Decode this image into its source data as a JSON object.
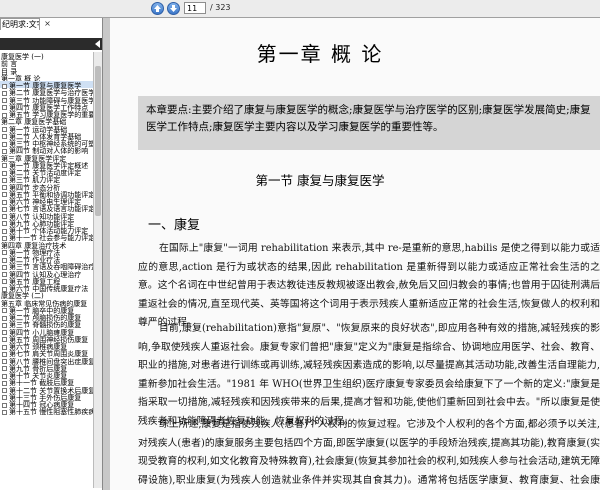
{
  "toolbar": {
    "up_icon": "arrow-up-icon",
    "down_icon": "arrow-down-icon",
    "current_page": "11",
    "total_pages": "/ 323"
  },
  "sidebar": {
    "tab_title": "纪明求:文字版",
    "close_glyph": "×",
    "outline": [
      {
        "level": 0,
        "text": "康复医学 (一)"
      },
      {
        "level": 0,
        "text": "前  言"
      },
      {
        "level": 0,
        "text": "目  录"
      },
      {
        "level": 0,
        "text": "第一章  概  论"
      },
      {
        "level": 2,
        "text": "第一节  康复与康复医学"
      },
      {
        "level": 2,
        "text": "第二节  康复医学与治疗医学"
      },
      {
        "level": 2,
        "text": "第三节  功能障碍与康复医学"
      },
      {
        "level": 2,
        "text": "第四节  康复医学工作特点"
      },
      {
        "level": 2,
        "text": "第五节  学习康复医学的重要性"
      },
      {
        "level": 0,
        "text": "第二章  康复医学基础"
      },
      {
        "level": 2,
        "text": "第一节  运动学基础"
      },
      {
        "level": 2,
        "text": "第二节  人体发育学基础"
      },
      {
        "level": 2,
        "text": "第三节  中枢神经系统的可塑性"
      },
      {
        "level": 2,
        "text": "第四节  制动对人体的影响"
      },
      {
        "level": 0,
        "text": "第三章  康复医学评定"
      },
      {
        "level": 2,
        "text": "第一节  康复医学评定概述"
      },
      {
        "level": 2,
        "text": "第二节  关节活动度评定"
      },
      {
        "level": 2,
        "text": "第三节  肌力评定"
      },
      {
        "level": 2,
        "text": "第四节  步态分析"
      },
      {
        "level": 2,
        "text": "第五节  平衡和协调功能评定"
      },
      {
        "level": 2,
        "text": "第六节  神经电生理评定"
      },
      {
        "level": 2,
        "text": "第七节  言语及语言功能评定"
      },
      {
        "level": 2,
        "text": "第八节  认知功能评定"
      },
      {
        "level": 2,
        "text": "第九节  心肺功能评定"
      },
      {
        "level": 2,
        "text": "第十节  个体活动能力评定"
      },
      {
        "level": 2,
        "text": "第十一节  社会参与能力评定"
      },
      {
        "level": 0,
        "text": "第四章  康复治疗技术"
      },
      {
        "level": 2,
        "text": "第一节  物理疗法"
      },
      {
        "level": 2,
        "text": "第二节  作业疗法"
      },
      {
        "level": 2,
        "text": "第三节  言语及吞咽障碍治疗"
      },
      {
        "level": 2,
        "text": "第四节  认知及心理治疗"
      },
      {
        "level": 2,
        "text": "第五节  康复工程"
      },
      {
        "level": 2,
        "text": "第六节  中国传统康复疗法"
      },
      {
        "level": 0,
        "text": "康复医学 (二)"
      },
      {
        "level": 0,
        "text": "第五章  临床常见伤病的康复"
      },
      {
        "level": 2,
        "text": "第一节  脑卒中的康复"
      },
      {
        "level": 2,
        "text": "第二节  颅脑损伤的康复"
      },
      {
        "level": 2,
        "text": "第三节  脊髓损伤的康复"
      },
      {
        "level": 2,
        "text": "第四节  小儿脑瘫康复"
      },
      {
        "level": 2,
        "text": "第五节  周围神经损伤康复"
      },
      {
        "level": 2,
        "text": "第六节  颈椎病康复"
      },
      {
        "level": 2,
        "text": "第七节  肩关节周围炎康复"
      },
      {
        "level": 2,
        "text": "第八节  腰椎间盘突出症康复"
      },
      {
        "level": 2,
        "text": "第九节  骨折后康复"
      },
      {
        "level": 2,
        "text": "第十节  关节炎康复"
      },
      {
        "level": 2,
        "text": "第十一节  截肢后康复"
      },
      {
        "level": 2,
        "text": "第十二节  关节置换术后康复"
      },
      {
        "level": 2,
        "text": "第十三节  手外伤后康复"
      },
      {
        "level": 2,
        "text": "第十四节  冠心病康复"
      },
      {
        "level": 2,
        "text": "第十五节  慢性阻塞性肺疾病康复"
      }
    ],
    "active_index": 4
  },
  "document": {
    "chapter_title": "第一章   概     论",
    "summary": "本章要点:主要介绍了康复与康复医学的概念;康复医学与治疗医学的区别;康复医学发展简史;康复医学工作特点;康复医学主要内容以及学习康复医学的重要性等。",
    "section_title": "第一节    康复与康复医学",
    "subsection_title": "一、康复",
    "paragraphs": [
      "在国际上\"康复\"一词用 rehabilitation 来表示,其中 re-是重新的意思,habilis 是使之得到以能力或适应的意思,action 是行为或状态的结果,因此 rehabilitation 是重新得到以能力或适应正常社会生活的之意。这个名词在中世纪曾用于表达教徒违反教规被逐出教会,赦免后又回归教会的事情;也曾用于囚徒刑满后重返社会的情况,直至现代英、英等国将这个词用于表示残疾人重新适应正常的社会生活,恢复做人的权利和尊严的过程。",
      "目前,康复(rehabilitation)意指\"复原\"、\"恢复原来的良好状态\",即应用各种有效的措施,减轻残疾的影响,争取使残疾人重返社会。康复专家们曾把\"康复\"定义为\"康复是指综合、协调地应用医学、社会、教育、职业的措施,对患者进行训练或再训练,减轻残疾因素造成的影响,以尽量提高其活动功能,改善生活自理能力,重新参加社会生活。\"1981 年 WHO(世界卫生组织)医疗康复专家委员会给康复下了一个新的定义:\"康复是指采取一切措施,减轻残疾和因残疾带来的后果,提高才智和功能,使他们重新回到社会中去。\"所以康复是使残疾者和功能障碍者恢复功能、恢复权利的过程。",
      "综上所述,康复是指使残疾人(患者)个人权利的恢复过程。它涉及个人权利的各个方面,都必须予以关注,对残疾人(患者)的康复服务主要包括四个方面,即医学康复(以医学的手段矫治残疾,提高其功能),教育康复(实现受教育的权利,如文化教育及特殊教育),社会康复(恢复其参加社会的权利,如残疾人参与社会活动,建筑无障碍设施),职业康复(为残疾人创造就业条件并实现其自食其力)。通常将包括医学康复、教育康复、社会康复、职业康复诸方面的康复工作称为全面康复或俗称大康复。目前社会上将\"康复\"一词与疾病后的恢复(recovery)混同,如某某人患肺炎被治愈,常常称某某人获得了\"康复\"。这种"
    ]
  }
}
